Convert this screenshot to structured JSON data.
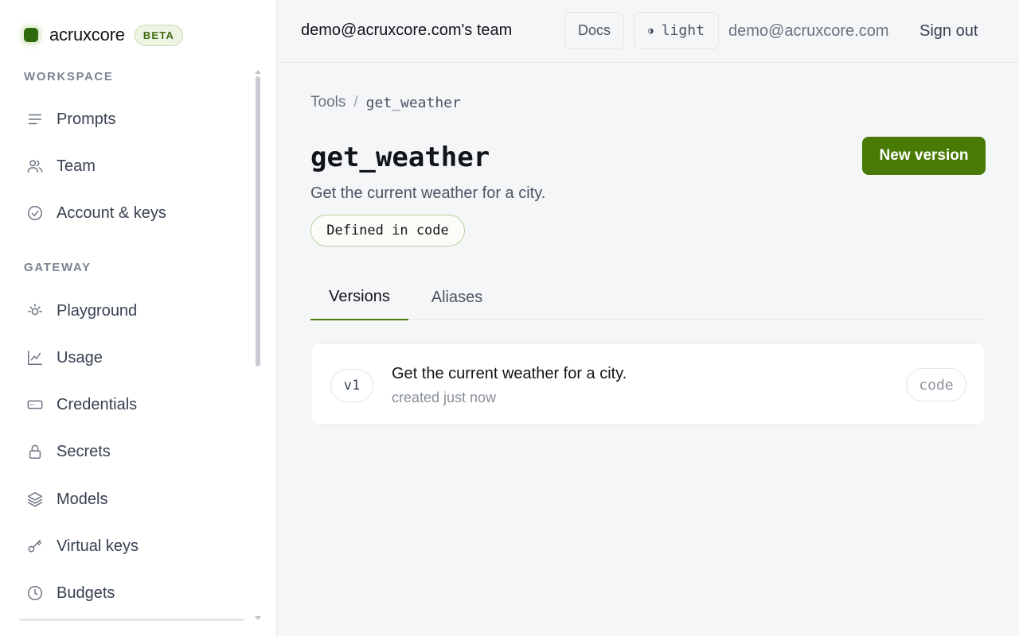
{
  "brand": {
    "name": "acruxcore",
    "badge": "BETA"
  },
  "colors": {
    "accent": "#4a7a06",
    "brand_dot": "#2f6b0a",
    "background": "#f5f6f8"
  },
  "sidebar": {
    "sections": [
      {
        "title": "WORKSPACE",
        "items": [
          {
            "label": "Prompts",
            "icon": "lines-icon"
          },
          {
            "label": "Team",
            "icon": "users-icon"
          },
          {
            "label": "Account & keys",
            "icon": "check-circle-icon"
          }
        ]
      },
      {
        "title": "GATEWAY",
        "items": [
          {
            "label": "Playground",
            "icon": "sun-icon"
          },
          {
            "label": "Usage",
            "icon": "chart-icon"
          },
          {
            "label": "Credentials",
            "icon": "card-icon"
          },
          {
            "label": "Secrets",
            "icon": "lock-icon"
          },
          {
            "label": "Models",
            "icon": "layers-icon"
          },
          {
            "label": "Virtual keys",
            "icon": "key-icon"
          },
          {
            "label": "Budgets",
            "icon": "clock-icon"
          }
        ]
      }
    ]
  },
  "header": {
    "team": "demo@acruxcore.com's team",
    "docs": "Docs",
    "theme_glyph": "◑",
    "theme": "light",
    "email": "demo@acruxcore.com",
    "signout": "Sign out"
  },
  "breadcrumb": {
    "parent": "Tools",
    "separator": "/",
    "current": "get_weather"
  },
  "tool": {
    "title": "get_weather",
    "description": "Get the current weather for a city.",
    "badge": "Defined in code",
    "new_version": "New version"
  },
  "tabs": [
    {
      "label": "Versions",
      "active": true
    },
    {
      "label": "Aliases",
      "active": false
    }
  ],
  "versions": [
    {
      "tag": "v1",
      "description": "Get the current weather for a city.",
      "meta": "created just now",
      "source": "code"
    }
  ]
}
